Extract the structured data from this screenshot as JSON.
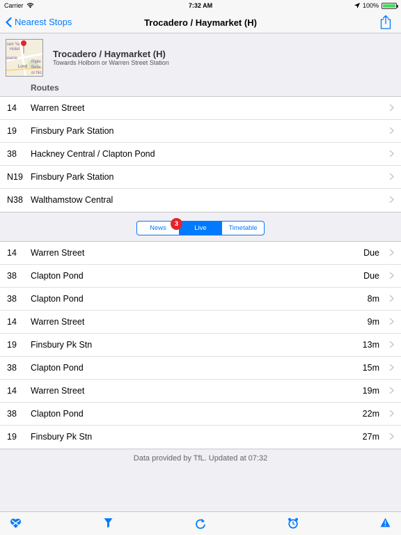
{
  "status_bar": {
    "carrier": "Carrier",
    "time": "7:32 AM",
    "battery": "100%"
  },
  "nav": {
    "back_label": "Nearest Stops",
    "title": "Trocadero / Haymarket (H)"
  },
  "stop": {
    "name": "Trocadero / Haymarket (H)",
    "subtitle": "Towards Holborn or Warren Street Station",
    "map_labels": [
      "iam Ya",
      "Hotel",
      "sserie",
      "Riple",
      "Belie",
      "or No",
      "Lond"
    ]
  },
  "routes_header": "Routes",
  "routes": [
    {
      "number": "14",
      "destination": "Warren Street"
    },
    {
      "number": "19",
      "destination": "Finsbury Park Station"
    },
    {
      "number": "38",
      "destination": "Hackney Central / Clapton Pond"
    },
    {
      "number": "N19",
      "destination": "Finsbury Park Station"
    },
    {
      "number": "N38",
      "destination": "Walthamstow Central"
    }
  ],
  "segments": {
    "items": [
      "News",
      "Live",
      "Timetable"
    ],
    "selected": "Live",
    "news_badge": "3"
  },
  "arrivals": [
    {
      "number": "14",
      "destination": "Warren Street",
      "eta": "Due"
    },
    {
      "number": "38",
      "destination": "Clapton Pond",
      "eta": "Due"
    },
    {
      "number": "38",
      "destination": "Clapton Pond",
      "eta": "8m"
    },
    {
      "number": "14",
      "destination": "Warren Street",
      "eta": "9m"
    },
    {
      "number": "19",
      "destination": "Finsbury Pk Stn",
      "eta": "13m"
    },
    {
      "number": "38",
      "destination": "Clapton Pond",
      "eta": "15m"
    },
    {
      "number": "14",
      "destination": "Warren Street",
      "eta": "19m"
    },
    {
      "number": "38",
      "destination": "Clapton Pond",
      "eta": "22m"
    },
    {
      "number": "19",
      "destination": "Finsbury Pk Stn",
      "eta": "27m"
    }
  ],
  "footer": "Data provided by TfL. Updated at 07:32",
  "toolbar": {
    "icons": [
      "favourite-heart-icon",
      "filter-icon",
      "refresh-icon",
      "alarm-clock-icon",
      "warning-icon"
    ]
  },
  "colors": {
    "accent": "#007aff",
    "badge": "#e0262b",
    "background": "#efeff4"
  }
}
